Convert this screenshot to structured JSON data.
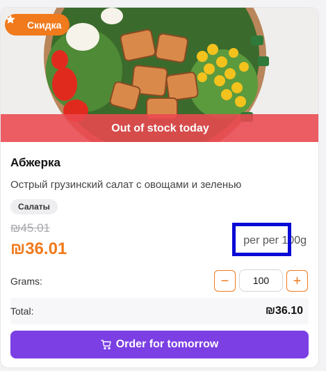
{
  "badge": {
    "label": "Скидка",
    "icon": "star-icon"
  },
  "stock_banner": "Out of stock today",
  "product": {
    "title": "Абжерка",
    "description": "Острый грузинский салат с овощами и зеленью",
    "tag": "Салаты",
    "old_price": "₪45.01",
    "price": "₪36.01",
    "unit": "per per 100g"
  },
  "quantity": {
    "label": "Grams:",
    "value": "100",
    "minus": "−",
    "plus": "+"
  },
  "total": {
    "label": "Total:",
    "value": "₪36.10"
  },
  "order_button": {
    "label": "Order for tomorrow",
    "icon": "cart-icon"
  },
  "colors": {
    "accent": "#f07a1c",
    "primary": "#7b3fe4",
    "banner": "#eb4850",
    "highlight": "#0a0ad6"
  }
}
